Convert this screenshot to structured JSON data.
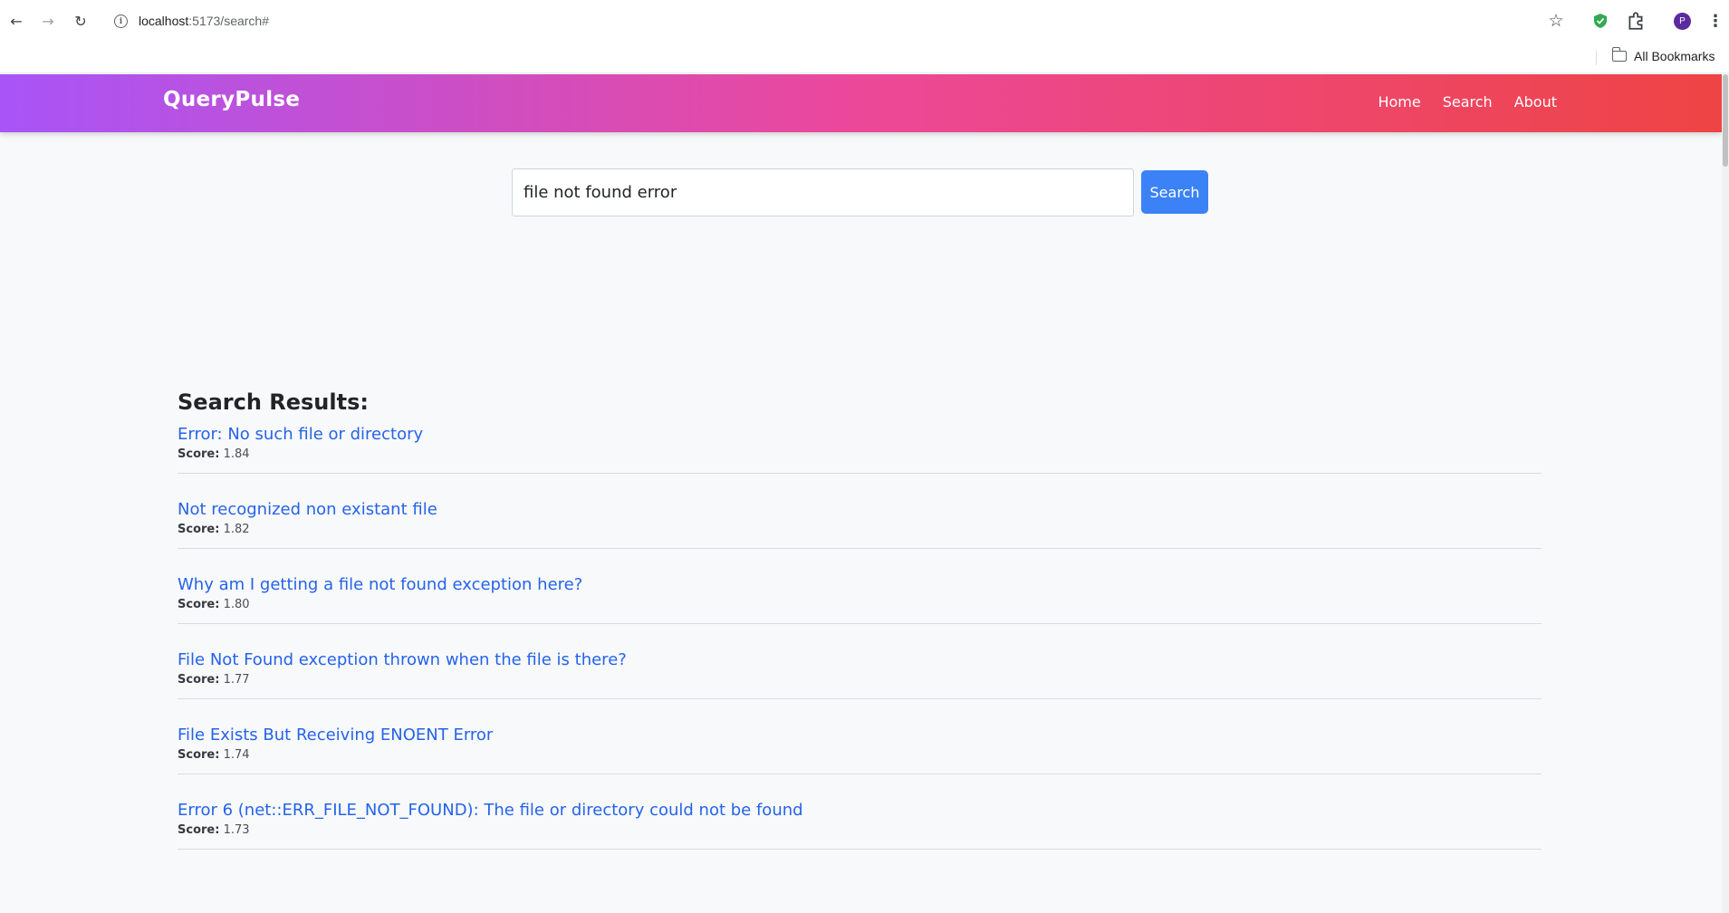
{
  "browser": {
    "url_host": "localhost",
    "url_rest": ":5173/search#",
    "profile_initial": "P",
    "bookmarks_label": "All Bookmarks"
  },
  "icons": {
    "back": "back-arrow-icon",
    "forward": "forward-arrow-icon",
    "reload": "reload-icon",
    "info": "info-icon",
    "star": "star-icon",
    "shield": "shield-icon",
    "extensions": "puzzle-icon",
    "menu": "kebab-menu-icon",
    "folder": "folder-icon"
  },
  "colors": {
    "navbar_gradient_start": "#a855f7",
    "navbar_gradient_mid": "#ec4899",
    "navbar_gradient_end": "#ef4444",
    "search_button": "#3b82f6",
    "link": "#2563eb"
  },
  "navbar": {
    "brand": "QueryPulse",
    "links": [
      "Home",
      "Search",
      "About"
    ]
  },
  "search": {
    "value": "file not found error",
    "button_label": "Search"
  },
  "results": {
    "heading": "Search Results:",
    "score_label": "Score:",
    "items": [
      {
        "title": "Error: No such file or directory",
        "score": "1.84"
      },
      {
        "title": "Not recognized non existant file",
        "score": "1.82"
      },
      {
        "title": "Why am I getting a file not found exception here?",
        "score": "1.80"
      },
      {
        "title": "File Not Found exception thrown when the file is there?",
        "score": "1.77"
      },
      {
        "title": "File Exists But Receiving ENOENT Error",
        "score": "1.74"
      },
      {
        "title": "Error 6 (net::ERR_FILE_NOT_FOUND): The file or directory could not be found",
        "score": "1.73"
      }
    ]
  }
}
